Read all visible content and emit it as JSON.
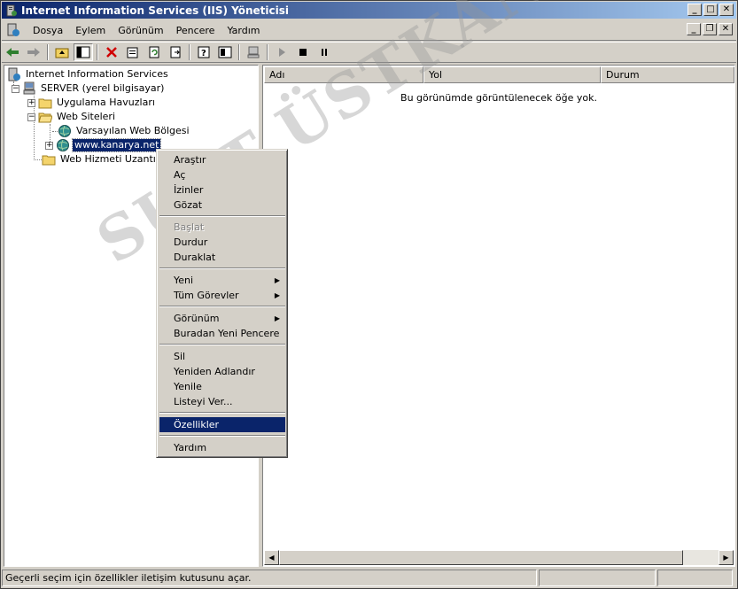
{
  "window": {
    "title": "Internet Information Services (IIS) Yöneticisi"
  },
  "menubar": {
    "items": [
      "Dosya",
      "Eylem",
      "Görünüm",
      "Pencere",
      "Yardım"
    ]
  },
  "tree": {
    "root": "Internet Information Services",
    "server": "SERVER (yerel bilgisayar)",
    "app_pools": "Uygulama Havuzları",
    "web_sites": "Web Siteleri",
    "default_site": "Varsayılan Web Bölgesi",
    "kanarya": "www.kanarya.net",
    "web_ext": "Web Hizmeti Uzantıları"
  },
  "list": {
    "columns": [
      "Adı",
      "Yol",
      "Durum"
    ],
    "empty_message": "Bu görünümde görüntülenecek öğe yok."
  },
  "context_menu": {
    "items": [
      "Araştır",
      "Aç",
      "İzinler",
      "Gözat",
      "Başlat",
      "Durdur",
      "Duraklat",
      "Yeni",
      "Tüm Görevler",
      "Görünüm",
      "Buradan Yeni Pencere",
      "Sil",
      "Yeniden Adlandır",
      "Yenile",
      "Listeyi Ver...",
      "Özellikler",
      "Yardım"
    ]
  },
  "status": {
    "text": "Geçerli seçim için özellikler iletişim kutusunu açar."
  },
  "watermark": "SUAT ÜSTKAN"
}
